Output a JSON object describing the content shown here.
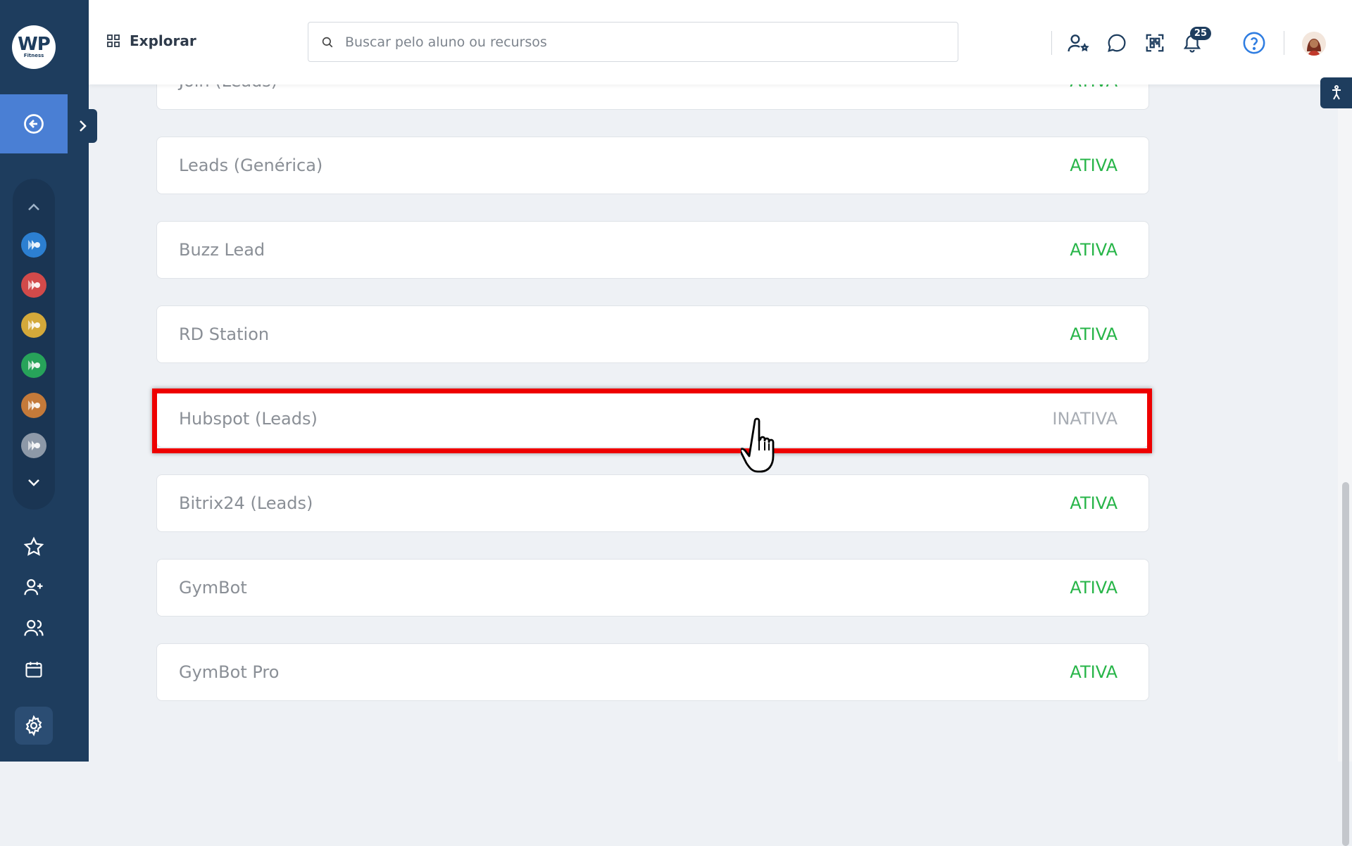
{
  "brand": {
    "logo_main": "WP",
    "logo_sub": "Fitness"
  },
  "header": {
    "explore_label": "Explorar",
    "search_placeholder": "Buscar pelo aluno ou recursos",
    "notifications_count": "25"
  },
  "sidebar": {
    "module_colors": [
      "#2c7fd1",
      "#d24a4a",
      "#d4a93a",
      "#27a35a",
      "#c47a3a",
      "#8d99a8"
    ]
  },
  "integrations": [
    {
      "name": "Join (Leads)",
      "status": "ATIVA",
      "active": true
    },
    {
      "name": "Leads (Genérica)",
      "status": "ATIVA",
      "active": true
    },
    {
      "name": "Buzz Lead",
      "status": "ATIVA",
      "active": true
    },
    {
      "name": "RD Station",
      "status": "ATIVA",
      "active": true
    },
    {
      "name": "Hubspot (Leads)",
      "status": "INATIVA",
      "active": false
    },
    {
      "name": "Bitrix24 (Leads)",
      "status": "ATIVA",
      "active": true
    },
    {
      "name": "GymBot",
      "status": "ATIVA",
      "active": true
    },
    {
      "name": "GymBot Pro",
      "status": "ATIVA",
      "active": true
    }
  ],
  "colors": {
    "active": "#27b548",
    "inactive": "#a8adb4",
    "highlight": "#ee0000",
    "sidebar": "#1e3d5e",
    "accent": "#4a7fd4"
  }
}
